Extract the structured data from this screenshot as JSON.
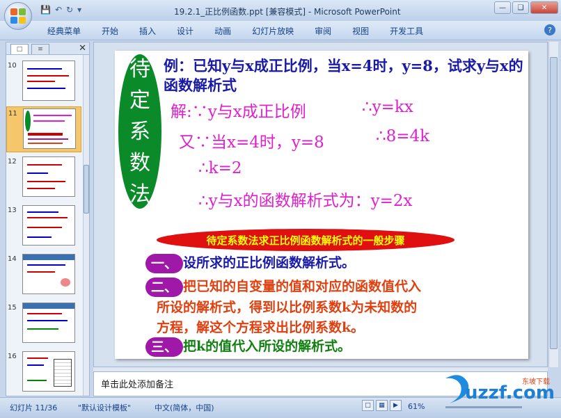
{
  "window": {
    "title": "19.2.1_正比例函数.ppt [兼容模式] - Microsoft PowerPoint"
  },
  "ribbon": {
    "tabs": [
      "经典菜单",
      "开始",
      "插入",
      "设计",
      "动画",
      "幻灯片放映",
      "审阅",
      "视图",
      "开发工具"
    ]
  },
  "slides_pane": {
    "numbers": [
      "10",
      "11",
      "12",
      "13",
      "14",
      "15",
      "16"
    ],
    "selected": "11"
  },
  "slide": {
    "oval_chars": [
      "待",
      "定",
      "系",
      "数",
      "法"
    ],
    "question": "例：已知y与x成正比例，当x=4时，y=8，试求y与x的函数解析式",
    "line1_a": "解:∵y与x成正比例",
    "line1_b": "∴y=kx",
    "line2_a": "又∵当x=4时，y=8",
    "line2_b": "∴8=4k",
    "line3": "∴k=2",
    "line4": "∴y与x的函数解析式为：y=2x",
    "banner": "待定系数法求正比例函数解析式的一般步骤",
    "step1_label": "一、",
    "step1_text": "设所求的正比例函数解析式。",
    "step2_label": "二、",
    "step2_text_1": "把已知的自变量的值和对应的函数值代入",
    "step2_text_2": "所设的解析式，得到以比例系数k为未知数的",
    "step2_text_3": "方程，解这个方程求出比例系数k。",
    "step3_label": "三、",
    "step3_text": "把k的值代入所设的解析式。"
  },
  "notes": {
    "placeholder": "单击此处添加备注"
  },
  "status": {
    "slide_info": "幻灯片 11/36",
    "template": "\"默认设计模板\"",
    "language": "中文(简体，中国)",
    "zoom": "61%"
  },
  "watermark": {
    "brand": "uzzf.com",
    "sub": "东坡下载"
  },
  "colors": {
    "oval": "#0b8a2a",
    "magenta": "#e020d0",
    "navy": "#1a1aa8",
    "banner_red": "#e01010",
    "step_pill": "#a018a8",
    "step2_text": "#e04010",
    "step3_text": "#108010"
  }
}
